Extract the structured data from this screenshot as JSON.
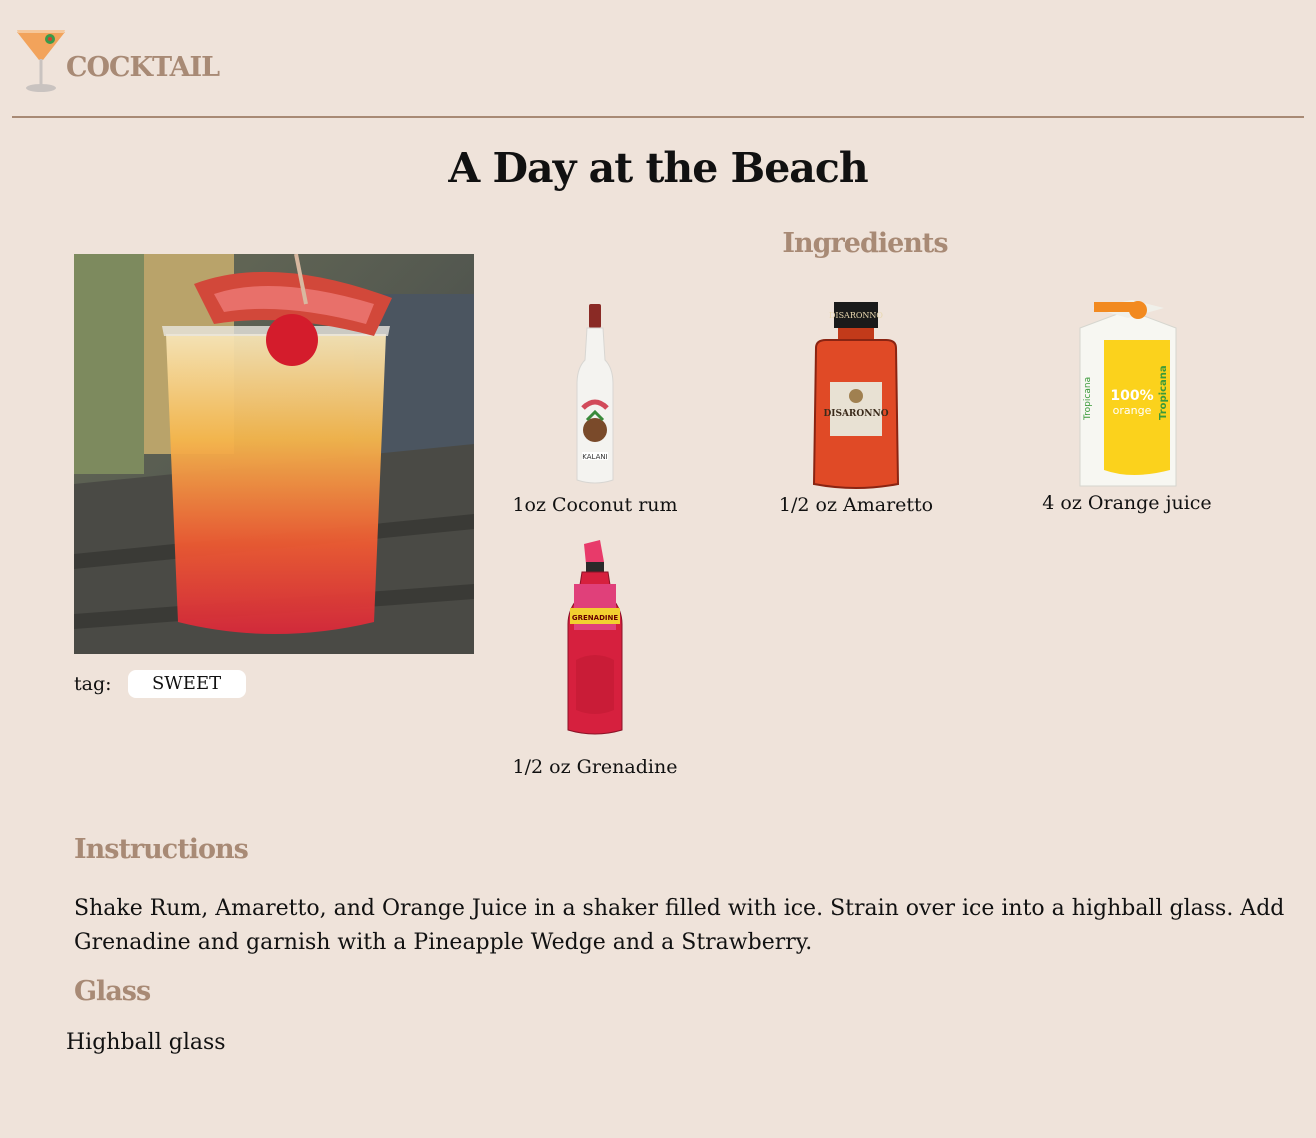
{
  "header": {
    "logo_text": "COCKTAIL",
    "logo_icon": "martini-glass-icon"
  },
  "drink": {
    "name": "A Day at the Beach",
    "tag_label": "tag:",
    "tags": [
      "SWEET"
    ]
  },
  "ingredients": {
    "heading": "Ingredients",
    "items": [
      {
        "label": "1oz Coconut rum",
        "icon": "coconut-rum-bottle"
      },
      {
        "label": "1/2 oz Amaretto",
        "icon": "amaretto-bottle"
      },
      {
        "label": "4 oz Orange juice",
        "icon": "orange-juice-carton"
      },
      {
        "label": "1/2 oz Grenadine",
        "icon": "grenadine-bottle"
      }
    ]
  },
  "instructions": {
    "heading": "Instructions",
    "text": "Shake Rum, Amaretto, and Orange Juice in a shaker filled with ice. Strain over ice into a highball glass. Add Grenadine and garnish with a Pineapple Wedge and a Strawberry."
  },
  "glass": {
    "heading": "Glass",
    "value": "Highball glass"
  },
  "colors": {
    "background": "#efe3da",
    "accent": "#a88a75",
    "tag_bg": "#ffffff"
  }
}
